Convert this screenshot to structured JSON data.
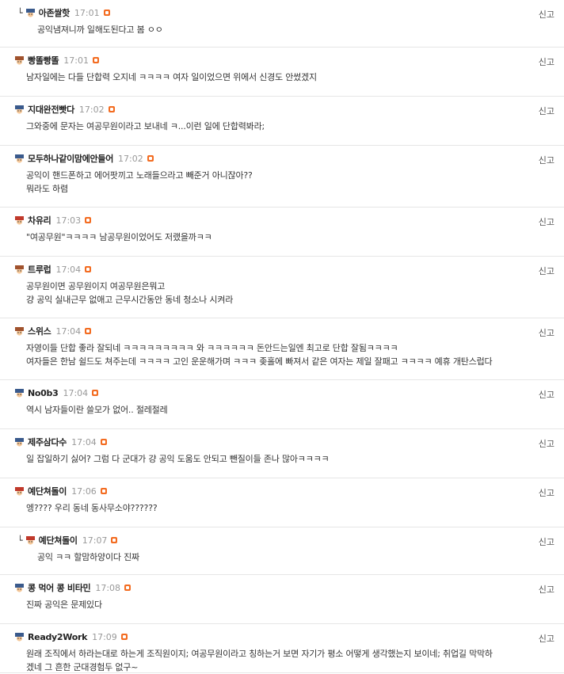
{
  "report_label": "신고",
  "comments": [
    {
      "nick": "아존쌀핫",
      "time": "17:01",
      "reply": true,
      "avatar": "blue",
      "lines": [
        "공익냄져니까 일해도된다고 봄 ㅇㅇ"
      ]
    },
    {
      "nick": "빵똘빵똘",
      "time": "17:01",
      "reply": false,
      "avatar": "brown",
      "lines": [
        "남자일에는 다들 단합력 오지네 ㅋㅋㅋㅋ 여자 일이었으면 위에서 신경도 안썼겠지"
      ]
    },
    {
      "nick": "지대완전빳다",
      "time": "17:02",
      "reply": false,
      "avatar": "blue",
      "lines": [
        "그와중에 문자는 여공무원이라고 보내네 ㅋ...이런 일에 단합력봐라;"
      ]
    },
    {
      "nick": "모두하나같이맘에안들어",
      "time": "17:02",
      "reply": false,
      "avatar": "blue",
      "lines": [
        "공익이 핸드폰하고 에어팟끼고 노래들으라고 빼준거 아니잖아??",
        "뭐라도 하렴"
      ]
    },
    {
      "nick": "차유리",
      "time": "17:03",
      "reply": false,
      "avatar": "red",
      "lines": [
        "\"여공무원\"ㅋㅋㅋㅋ 남공무원이었어도 저랬을까ㅋㅋ"
      ]
    },
    {
      "nick": "트루럽",
      "time": "17:04",
      "reply": false,
      "avatar": "brown",
      "lines": [
        "공무원이면 공무원이지 여공무원은뭐고",
        "걍 공익 실내근무 없애고 근무시간동안 동네 청소나 시켜라"
      ]
    },
    {
      "nick": "스위스",
      "time": "17:04",
      "reply": false,
      "avatar": "brown",
      "lines": [
        "자영이들 단합 좋라 잘되네 ㅋㅋㅋㅋㅋㅋㅋㅋㅋ 와 ㅋㅋㅋㅋㅋㅋ 돈안드는일엔 최고로 단합 잘됨ㅋㅋㅋㅋ",
        "여자들은 한남 쉴드도 쳐주는데 ㅋㅋㅋㅋ 고인 운운해가며 ㅋㅋㅋ 좆홀에 빠져서 같은 여자는 제일 잘패고 ㅋㅋㅋㅋ 예휴 개탄스럽다"
      ]
    },
    {
      "nick": "No0b3",
      "time": "17:04",
      "reply": false,
      "avatar": "blue",
      "lines": [
        "역시 남자들이란 쓸모가 없어.. 절레절레"
      ]
    },
    {
      "nick": "제주삼다수",
      "time": "17:04",
      "reply": false,
      "avatar": "blue",
      "lines": [
        "일 잡일하기 싫어? 그럼 다 군대가 걍 공익 도움도 안되고 뺀질이들 존나 많아ㅋㅋㅋㅋ"
      ]
    },
    {
      "nick": "예단쳐돌이",
      "time": "17:06",
      "reply": false,
      "avatar": "red",
      "lines": [
        "엥???? 우리 동네 동사무소야??????"
      ]
    },
    {
      "nick": "예단쳐돌이",
      "time": "17:07",
      "reply": true,
      "avatar": "red",
      "lines": [
        "공익 ㅋㅋ 할맘하양이다 진짜"
      ]
    },
    {
      "nick": "콩 먹어 콩 비타민",
      "time": "17:08",
      "reply": false,
      "avatar": "blue",
      "lines": [
        "진짜 공익은 문제있다"
      ]
    },
    {
      "nick": "Ready2Work",
      "time": "17:09",
      "reply": false,
      "avatar": "blue",
      "lines": [
        "원래 조직에서 하라는대로 하는게 조직원이지; 여공무원이라고 칭하는거 보면 자기가 평소 어떻게 생각했는지 보이네; 취업길 막막하",
        "겠네 그 흔한 군대경험두 없구~"
      ]
    }
  ]
}
